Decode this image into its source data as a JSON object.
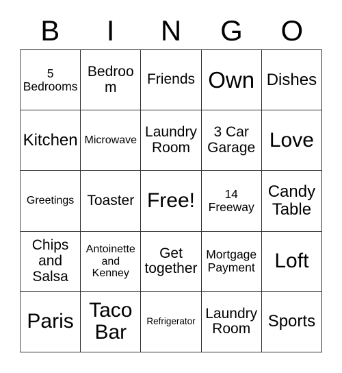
{
  "card": {
    "title": "BINGO Card",
    "headers": [
      "B",
      "I",
      "N",
      "G",
      "O"
    ],
    "free_space_label": "Free!",
    "colors": {
      "background": "#ffffff",
      "text": "#000000",
      "grid_line": "#2b2b2b"
    },
    "rows": [
      [
        {
          "text": "5\nBedrooms",
          "size": "fs-md"
        },
        {
          "text": "Bedroom",
          "size": "fs-lg"
        },
        {
          "text": "Friends",
          "size": "fs-lg"
        },
        {
          "text": "Own",
          "size": "fs-huge"
        },
        {
          "text": "Dishes",
          "size": "fs-xl"
        }
      ],
      [
        {
          "text": "Kitchen",
          "size": "fs-xl"
        },
        {
          "text": "Microwave",
          "size": "fs-sm"
        },
        {
          "text": "Laundry\nRoom",
          "size": "fs-lg"
        },
        {
          "text": "3 Car\nGarage",
          "size": "fs-lg"
        },
        {
          "text": "Love",
          "size": "fs-xxl"
        }
      ],
      [
        {
          "text": "Greetings",
          "size": "fs-sm"
        },
        {
          "text": "Toaster",
          "size": "fs-lg"
        },
        {
          "text": "Free!",
          "size": "fs-xxl"
        },
        {
          "text": "14\nFreeway",
          "size": "fs-md"
        },
        {
          "text": "Candy\nTable",
          "size": "fs-xl"
        }
      ],
      [
        {
          "text": "Chips\nand\nSalsa",
          "size": "fs-lg"
        },
        {
          "text": "Antoinette\nand\nKenney",
          "size": "fs-sm"
        },
        {
          "text": "Get\ntogether",
          "size": "fs-lg"
        },
        {
          "text": "Mortgage\nPayment",
          "size": "fs-md"
        },
        {
          "text": "Loft",
          "size": "fs-xxl"
        }
      ],
      [
        {
          "text": "Paris",
          "size": "fs-xxl"
        },
        {
          "text": "Taco\nBar",
          "size": "fs-xxl"
        },
        {
          "text": "Refrigerator",
          "size": "fs-xs"
        },
        {
          "text": "Laundry\nRoom",
          "size": "fs-lg"
        },
        {
          "text": "Sports",
          "size": "fs-xl"
        }
      ]
    ]
  }
}
